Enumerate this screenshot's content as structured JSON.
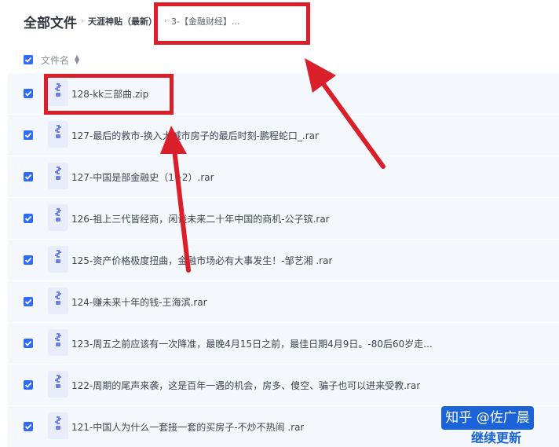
{
  "header": {
    "title": "全部文件",
    "crumb_separator": "›",
    "breadcrumb": [
      "天涯神贴（最新）",
      "3-【金融财经】..."
    ]
  },
  "table": {
    "column_file_name": "文件名",
    "sort_icon": "sort-icon",
    "files": [
      "128-kk三部曲.zip",
      "127-最后的救市-换入大城市房子的最后时刻-鹏程蛇口_.rar",
      "127-中国是部金融史（1+2）.rar",
      "126-祖上三代皆经商，闲谈未来二十年中国的商机-公子镔.rar",
      "125-资产价格极度扭曲，金融市场必有大事发生！-邹艺湘 .rar",
      "124-赚未来十年的钱-王海滨.rar",
      "123-周五之前应该有一次降准，最晚4月15日之前，最佳日期4月9日。-80后60岁走...",
      "122-周期的尾声来袭，这是百年一遇的机会，房多、傻空、骗子也可以进来受教.rar",
      "121-中国人为什么一套接一套的买房子-不炒不热闹 .rar"
    ]
  },
  "watermark": {
    "label": "知乎 @佐广晨",
    "sub": "继续更新"
  },
  "colors": {
    "accent": "#2f6cf6",
    "row_bg": "#f4f7fc",
    "annotation": "#d9202a",
    "watermark": "#1b63d8"
  }
}
